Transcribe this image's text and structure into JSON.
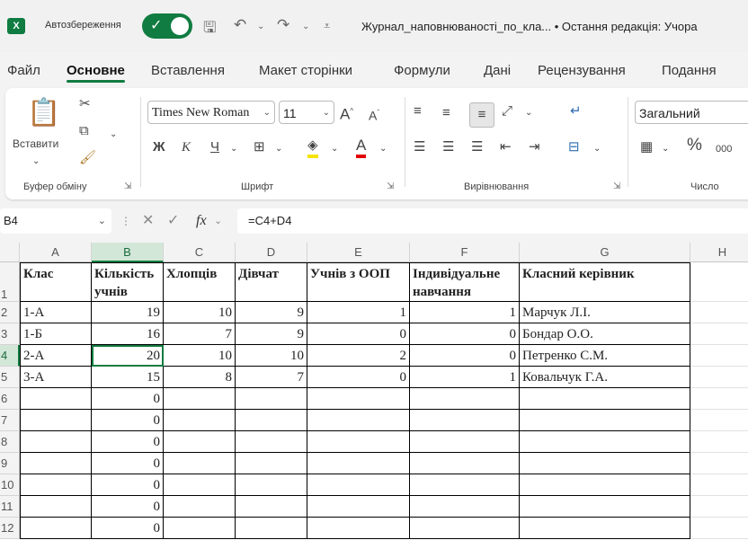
{
  "titlebar": {
    "app_icon": "X",
    "autosave_label": "Автозбереження",
    "autosave_on": true,
    "doc_title": "Журнал_наповнюваності_по_кла... • Остання редакція: Учора"
  },
  "tabs": [
    "Файл",
    "Основне",
    "Вставлення",
    "Макет сторінки",
    "Формули",
    "Дані",
    "Рецензування",
    "Подання"
  ],
  "active_tab": "Основне",
  "ribbon": {
    "clipboard": {
      "paste_label": "Вставити",
      "group_label": "Буфер обміну"
    },
    "font": {
      "font_name": "Times New Roman",
      "font_size": "11",
      "group_label": "Шрифт",
      "bold": "Ж",
      "italic": "К",
      "underline": "Ч"
    },
    "alignment": {
      "group_label": "Вирівнювання"
    },
    "number": {
      "format": "Загальний",
      "group_label": "Число",
      "percent": "%",
      "thousands": "000"
    }
  },
  "formula_bar": {
    "cell_ref": "B4",
    "fx": "fx",
    "formula": "=C4+D4"
  },
  "columns": [
    "A",
    "B",
    "C",
    "D",
    "E",
    "F",
    "G",
    "H"
  ],
  "selected_column": "B",
  "selected_row": "4",
  "rows": [
    {
      "n": "1",
      "cells": [
        "Клас",
        "Кількість учнів",
        "Хлопців",
        "Дівчат",
        "Учнів з ООП",
        "Індивідуальне навчання",
        "Класний керівник"
      ]
    },
    {
      "n": "2",
      "cells": [
        "1-А",
        "19",
        "10",
        "9",
        "1",
        "1",
        "Марчук Л.І."
      ]
    },
    {
      "n": "3",
      "cells": [
        "1-Б",
        "16",
        "7",
        "9",
        "0",
        "0",
        "Бондар О.О."
      ]
    },
    {
      "n": "4",
      "cells": [
        "2-А",
        "20",
        "10",
        "10",
        "2",
        "0",
        "Петренко С.М."
      ]
    },
    {
      "n": "5",
      "cells": [
        "3-А",
        "15",
        "8",
        "7",
        "0",
        "1",
        "Ковальчук Г.А."
      ]
    },
    {
      "n": "6",
      "cells": [
        "",
        "0",
        "",
        "",
        "",
        "",
        ""
      ]
    },
    {
      "n": "7",
      "cells": [
        "",
        "0",
        "",
        "",
        "",
        "",
        ""
      ]
    },
    {
      "n": "8",
      "cells": [
        "",
        "0",
        "",
        "",
        "",
        "",
        ""
      ]
    },
    {
      "n": "9",
      "cells": [
        "",
        "0",
        "",
        "",
        "",
        "",
        ""
      ]
    },
    {
      "n": "10",
      "cells": [
        "",
        "0",
        "",
        "",
        "",
        "",
        ""
      ]
    },
    {
      "n": "11",
      "cells": [
        "",
        "0",
        "",
        "",
        "",
        "",
        ""
      ]
    },
    {
      "n": "12",
      "cells": [
        "",
        "0",
        "",
        "",
        "",
        "",
        ""
      ]
    }
  ],
  "colors": {
    "accent": "#107c41",
    "selection_header": "#d3e7d9"
  }
}
